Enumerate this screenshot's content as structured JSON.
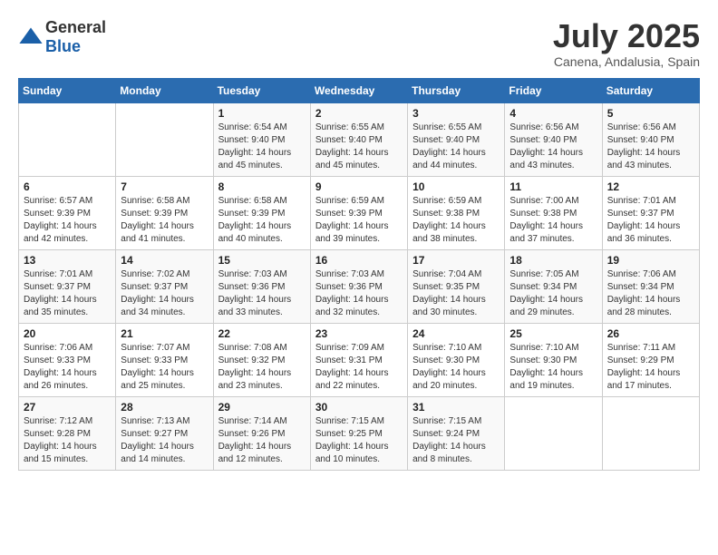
{
  "logo": {
    "general": "General",
    "blue": "Blue"
  },
  "title": {
    "month_year": "July 2025",
    "location": "Canena, Andalusia, Spain"
  },
  "days_of_week": [
    "Sunday",
    "Monday",
    "Tuesday",
    "Wednesday",
    "Thursday",
    "Friday",
    "Saturday"
  ],
  "weeks": [
    [
      {
        "day": "",
        "sunrise": "",
        "sunset": "",
        "daylight": ""
      },
      {
        "day": "",
        "sunrise": "",
        "sunset": "",
        "daylight": ""
      },
      {
        "day": "1",
        "sunrise": "Sunrise: 6:54 AM",
        "sunset": "Sunset: 9:40 PM",
        "daylight": "Daylight: 14 hours and 45 minutes."
      },
      {
        "day": "2",
        "sunrise": "Sunrise: 6:55 AM",
        "sunset": "Sunset: 9:40 PM",
        "daylight": "Daylight: 14 hours and 45 minutes."
      },
      {
        "day": "3",
        "sunrise": "Sunrise: 6:55 AM",
        "sunset": "Sunset: 9:40 PM",
        "daylight": "Daylight: 14 hours and 44 minutes."
      },
      {
        "day": "4",
        "sunrise": "Sunrise: 6:56 AM",
        "sunset": "Sunset: 9:40 PM",
        "daylight": "Daylight: 14 hours and 43 minutes."
      },
      {
        "day": "5",
        "sunrise": "Sunrise: 6:56 AM",
        "sunset": "Sunset: 9:40 PM",
        "daylight": "Daylight: 14 hours and 43 minutes."
      }
    ],
    [
      {
        "day": "6",
        "sunrise": "Sunrise: 6:57 AM",
        "sunset": "Sunset: 9:39 PM",
        "daylight": "Daylight: 14 hours and 42 minutes."
      },
      {
        "day": "7",
        "sunrise": "Sunrise: 6:58 AM",
        "sunset": "Sunset: 9:39 PM",
        "daylight": "Daylight: 14 hours and 41 minutes."
      },
      {
        "day": "8",
        "sunrise": "Sunrise: 6:58 AM",
        "sunset": "Sunset: 9:39 PM",
        "daylight": "Daylight: 14 hours and 40 minutes."
      },
      {
        "day": "9",
        "sunrise": "Sunrise: 6:59 AM",
        "sunset": "Sunset: 9:39 PM",
        "daylight": "Daylight: 14 hours and 39 minutes."
      },
      {
        "day": "10",
        "sunrise": "Sunrise: 6:59 AM",
        "sunset": "Sunset: 9:38 PM",
        "daylight": "Daylight: 14 hours and 38 minutes."
      },
      {
        "day": "11",
        "sunrise": "Sunrise: 7:00 AM",
        "sunset": "Sunset: 9:38 PM",
        "daylight": "Daylight: 14 hours and 37 minutes."
      },
      {
        "day": "12",
        "sunrise": "Sunrise: 7:01 AM",
        "sunset": "Sunset: 9:37 PM",
        "daylight": "Daylight: 14 hours and 36 minutes."
      }
    ],
    [
      {
        "day": "13",
        "sunrise": "Sunrise: 7:01 AM",
        "sunset": "Sunset: 9:37 PM",
        "daylight": "Daylight: 14 hours and 35 minutes."
      },
      {
        "day": "14",
        "sunrise": "Sunrise: 7:02 AM",
        "sunset": "Sunset: 9:37 PM",
        "daylight": "Daylight: 14 hours and 34 minutes."
      },
      {
        "day": "15",
        "sunrise": "Sunrise: 7:03 AM",
        "sunset": "Sunset: 9:36 PM",
        "daylight": "Daylight: 14 hours and 33 minutes."
      },
      {
        "day": "16",
        "sunrise": "Sunrise: 7:03 AM",
        "sunset": "Sunset: 9:36 PM",
        "daylight": "Daylight: 14 hours and 32 minutes."
      },
      {
        "day": "17",
        "sunrise": "Sunrise: 7:04 AM",
        "sunset": "Sunset: 9:35 PM",
        "daylight": "Daylight: 14 hours and 30 minutes."
      },
      {
        "day": "18",
        "sunrise": "Sunrise: 7:05 AM",
        "sunset": "Sunset: 9:34 PM",
        "daylight": "Daylight: 14 hours and 29 minutes."
      },
      {
        "day": "19",
        "sunrise": "Sunrise: 7:06 AM",
        "sunset": "Sunset: 9:34 PM",
        "daylight": "Daylight: 14 hours and 28 minutes."
      }
    ],
    [
      {
        "day": "20",
        "sunrise": "Sunrise: 7:06 AM",
        "sunset": "Sunset: 9:33 PM",
        "daylight": "Daylight: 14 hours and 26 minutes."
      },
      {
        "day": "21",
        "sunrise": "Sunrise: 7:07 AM",
        "sunset": "Sunset: 9:33 PM",
        "daylight": "Daylight: 14 hours and 25 minutes."
      },
      {
        "day": "22",
        "sunrise": "Sunrise: 7:08 AM",
        "sunset": "Sunset: 9:32 PM",
        "daylight": "Daylight: 14 hours and 23 minutes."
      },
      {
        "day": "23",
        "sunrise": "Sunrise: 7:09 AM",
        "sunset": "Sunset: 9:31 PM",
        "daylight": "Daylight: 14 hours and 22 minutes."
      },
      {
        "day": "24",
        "sunrise": "Sunrise: 7:10 AM",
        "sunset": "Sunset: 9:30 PM",
        "daylight": "Daylight: 14 hours and 20 minutes."
      },
      {
        "day": "25",
        "sunrise": "Sunrise: 7:10 AM",
        "sunset": "Sunset: 9:30 PM",
        "daylight": "Daylight: 14 hours and 19 minutes."
      },
      {
        "day": "26",
        "sunrise": "Sunrise: 7:11 AM",
        "sunset": "Sunset: 9:29 PM",
        "daylight": "Daylight: 14 hours and 17 minutes."
      }
    ],
    [
      {
        "day": "27",
        "sunrise": "Sunrise: 7:12 AM",
        "sunset": "Sunset: 9:28 PM",
        "daylight": "Daylight: 14 hours and 15 minutes."
      },
      {
        "day": "28",
        "sunrise": "Sunrise: 7:13 AM",
        "sunset": "Sunset: 9:27 PM",
        "daylight": "Daylight: 14 hours and 14 minutes."
      },
      {
        "day": "29",
        "sunrise": "Sunrise: 7:14 AM",
        "sunset": "Sunset: 9:26 PM",
        "daylight": "Daylight: 14 hours and 12 minutes."
      },
      {
        "day": "30",
        "sunrise": "Sunrise: 7:15 AM",
        "sunset": "Sunset: 9:25 PM",
        "daylight": "Daylight: 14 hours and 10 minutes."
      },
      {
        "day": "31",
        "sunrise": "Sunrise: 7:15 AM",
        "sunset": "Sunset: 9:24 PM",
        "daylight": "Daylight: 14 hours and 8 minutes."
      },
      {
        "day": "",
        "sunrise": "",
        "sunset": "",
        "daylight": ""
      },
      {
        "day": "",
        "sunrise": "",
        "sunset": "",
        "daylight": ""
      }
    ]
  ]
}
